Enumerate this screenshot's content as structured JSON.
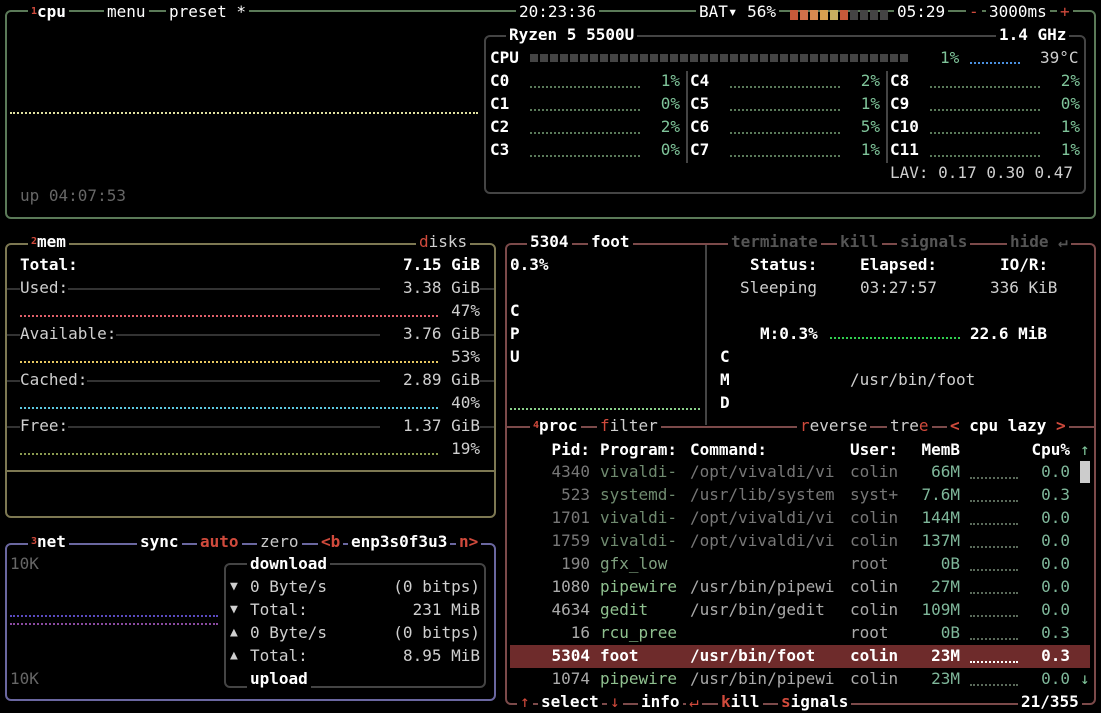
{
  "colors": {
    "cpu_border": "#5b7a58",
    "mem_border": "#7d7852",
    "net_border": "#6a67a0",
    "proc_border": "#7c4a4a",
    "hotkey": "#d04a3c",
    "selected_row": "#6e2b2b"
  },
  "cpu": {
    "num": "1",
    "title": "cpu",
    "menu": "menu",
    "preset": "preset *",
    "clock": "20:23:36",
    "battery_label": "BAT▾ 56%",
    "battery_percent": 56,
    "battery_time": "05:29",
    "rate_minus": "-",
    "rate": "3000ms",
    "rate_plus": "+",
    "uptime": "up 04:07:53",
    "model": "Ryzen 5 5500U",
    "freq": "1.4 GHz",
    "total_label": "CPU",
    "total_pct": "1%",
    "temp": "39°C",
    "cores": [
      {
        "label": "C0",
        "pct": "1%"
      },
      {
        "label": "C1",
        "pct": "0%"
      },
      {
        "label": "C2",
        "pct": "2%"
      },
      {
        "label": "C3",
        "pct": "0%"
      },
      {
        "label": "C4",
        "pct": "2%"
      },
      {
        "label": "C5",
        "pct": "1%"
      },
      {
        "label": "C6",
        "pct": "5%"
      },
      {
        "label": "C7",
        "pct": "1%"
      },
      {
        "label": "C8",
        "pct": "2%"
      },
      {
        "label": "C9",
        "pct": "0%"
      },
      {
        "label": "C10",
        "pct": "1%"
      },
      {
        "label": "C11",
        "pct": "1%"
      }
    ],
    "lav": "LAV: 0.17 0.30 0.47"
  },
  "mem": {
    "num": "2",
    "title": "mem",
    "disks": "disks",
    "total_label": "Total:",
    "total": "7.15 GiB",
    "rows": [
      {
        "label": "Used:",
        "value": "3.38 GiB",
        "pct": "47%",
        "color": "#e0606a"
      },
      {
        "label": "Available:",
        "value": "3.76 GiB",
        "pct": "53%",
        "color": "#e8c860"
      },
      {
        "label": "Cached:",
        "value": "2.89 GiB",
        "pct": "40%",
        "color": "#5cc8e0"
      },
      {
        "label": "Free:",
        "value": "1.37 GiB",
        "pct": "19%",
        "color": "#8a9a50"
      }
    ]
  },
  "net": {
    "num": "3",
    "title": "net",
    "sync": "sync",
    "auto": "auto",
    "zero": "zero",
    "prev": "<b",
    "iface": "enp3s0f3u3",
    "next": "n>",
    "scale_top": "10K",
    "scale_bottom": "10K",
    "download": "download",
    "upload": "upload",
    "rows": [
      {
        "icon": "▼",
        "label": "0 Byte/s",
        "value": "(0 bitps)"
      },
      {
        "icon": "▼",
        "label": "Total:",
        "value": "231 MiB"
      },
      {
        "icon": "▲",
        "label": "0 Byte/s",
        "value": "(0 bitps)"
      },
      {
        "icon": "▲",
        "label": "Total:",
        "value": "8.95 MiB"
      }
    ]
  },
  "detail": {
    "pid": "5304",
    "name": "foot",
    "terminate": "terminate",
    "kill": "kill",
    "signals": "signals",
    "hide": "hide ↵",
    "cpu_pct": "0.3%",
    "cpu_vert": [
      "C",
      "P",
      "U"
    ],
    "status_label": "Status:",
    "status": "Sleeping",
    "elapsed_label": "Elapsed:",
    "elapsed": "03:27:57",
    "io_label": "IO/R:",
    "io": "336 KiB",
    "mem_label": "M:0.3%",
    "mem": "22.6 MiB",
    "cmd_vert": [
      "C",
      "M",
      "D"
    ],
    "cmd": "/usr/bin/foot"
  },
  "proc": {
    "num": "4",
    "title": "proc",
    "filter": "filter",
    "reverse": "reverse",
    "tree": "tree",
    "sort": "< cpu lazy >",
    "headers": {
      "pid": "Pid:",
      "program": "Program:",
      "command": "Command:",
      "user": "User:",
      "mem": "MemB",
      "cpu": "Cpu%"
    },
    "rows": [
      {
        "pid": "4340",
        "program": "vivaldi-",
        "command": "/opt/vivaldi/vi",
        "user": "colin",
        "mem": "66M",
        "cpu": "0.0",
        "tone": "dim"
      },
      {
        "pid": "523",
        "program": "systemd-",
        "command": "/usr/lib/system",
        "user": "syst+",
        "mem": "7.6M",
        "cpu": "0.3",
        "tone": "dim"
      },
      {
        "pid": "1701",
        "program": "vivaldi-",
        "command": "/opt/vivaldi/vi",
        "user": "colin",
        "mem": "144M",
        "cpu": "0.0",
        "tone": "dim"
      },
      {
        "pid": "1759",
        "program": "vivaldi-",
        "command": "/opt/vivaldi/vi",
        "user": "colin",
        "mem": "137M",
        "cpu": "0.0",
        "tone": "dim"
      },
      {
        "pid": "190",
        "program": "gfx_low",
        "command": "",
        "user": "root",
        "mem": "0B",
        "cpu": "0.0",
        "tone": "mid"
      },
      {
        "pid": "1080",
        "program": "pipewire",
        "command": "/usr/bin/pipewi",
        "user": "colin",
        "mem": "27M",
        "cpu": "0.0",
        "tone": "normal"
      },
      {
        "pid": "4634",
        "program": "gedit",
        "command": "/usr/bin/gedit",
        "user": "colin",
        "mem": "109M",
        "cpu": "0.0",
        "tone": "normal"
      },
      {
        "pid": "16",
        "program": "rcu_pree",
        "command": "",
        "user": "root",
        "mem": "0B",
        "cpu": "0.3",
        "tone": "normal"
      },
      {
        "pid": "5304",
        "program": "foot",
        "command": "/usr/bin/foot",
        "user": "colin",
        "mem": "23M",
        "cpu": "0.3",
        "tone": "selected"
      },
      {
        "pid": "1074",
        "program": "pipewire",
        "command": "/usr/bin/pipewi",
        "user": "colin",
        "mem": "23M",
        "cpu": "0.0",
        "tone": "normal"
      }
    ],
    "select": "select",
    "info": "info",
    "kill": "kill",
    "signals": "signals",
    "count": "21/355",
    "scroll_up": "↑",
    "scroll_down": "↓"
  }
}
